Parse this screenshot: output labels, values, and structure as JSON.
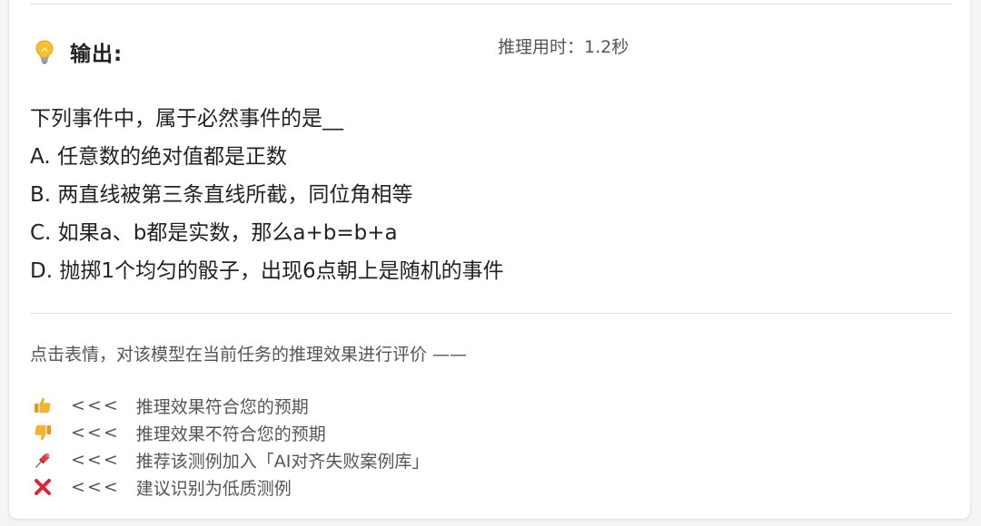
{
  "output": {
    "title": "输出:",
    "icon": "lightbulb-icon",
    "inference_time": "推理用时：1.2秒"
  },
  "question": {
    "stem": "下列事件中，属于必然事件的是__",
    "options": [
      "A. 任意数的绝对值都是正数",
      "B. 两直线被第三条直线所截，同位角相等",
      "C. 如果a、b都是实数，那么a+b=b+a",
      "D. 抛掷1个均匀的骰子，出现6点朝上是随机的事件"
    ]
  },
  "evaluation": {
    "prompt": "点击表情，对该模型在当前任务的推理效果进行评价 ——",
    "items": [
      {
        "icon": "thumbs-up-icon",
        "arrows": "<<<",
        "label": "推理效果符合您的预期"
      },
      {
        "icon": "thumbs-down-icon",
        "arrows": "<<<",
        "label": "推理效果不符合您的预期"
      },
      {
        "icon": "pushpin-icon",
        "arrows": "<<<",
        "label": "推荐该测例加入「AI对齐失败案例库」"
      },
      {
        "icon": "cross-mark-icon",
        "arrows": "<<<",
        "label": "建议识别为低质测例"
      }
    ]
  },
  "colors": {
    "thumb": "#f2b233",
    "pin": "#e03b3b",
    "cross": "#e0243a"
  }
}
